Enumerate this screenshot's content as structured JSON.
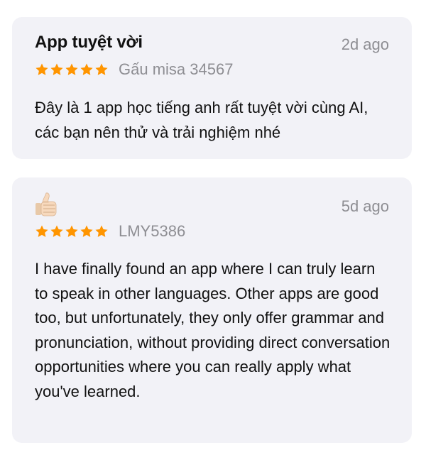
{
  "reviews": [
    {
      "title": "App tuyệt vời",
      "date": "2d ago",
      "rating": 5,
      "author": "Gấu misa 34567",
      "body": "Đây là 1 app học tiếng anh rất tuyệt vời cùng AI, các bạn nên thử và trải nghiệm nhé"
    },
    {
      "title_icon": "thumbs-up-emoji",
      "date": "5d ago",
      "rating": 5,
      "author": "LMY5386",
      "body": "I have finally found an app where I can truly learn to speak in other languages. Other apps are good too, but unfortunately, they only offer grammar and pronunciation, without providing direct conversation opportunities where you can really apply what you've learned."
    }
  ],
  "colors": {
    "star": "#ff9500",
    "card_bg": "#f2f2f7",
    "secondary_text": "#8e8e93"
  }
}
